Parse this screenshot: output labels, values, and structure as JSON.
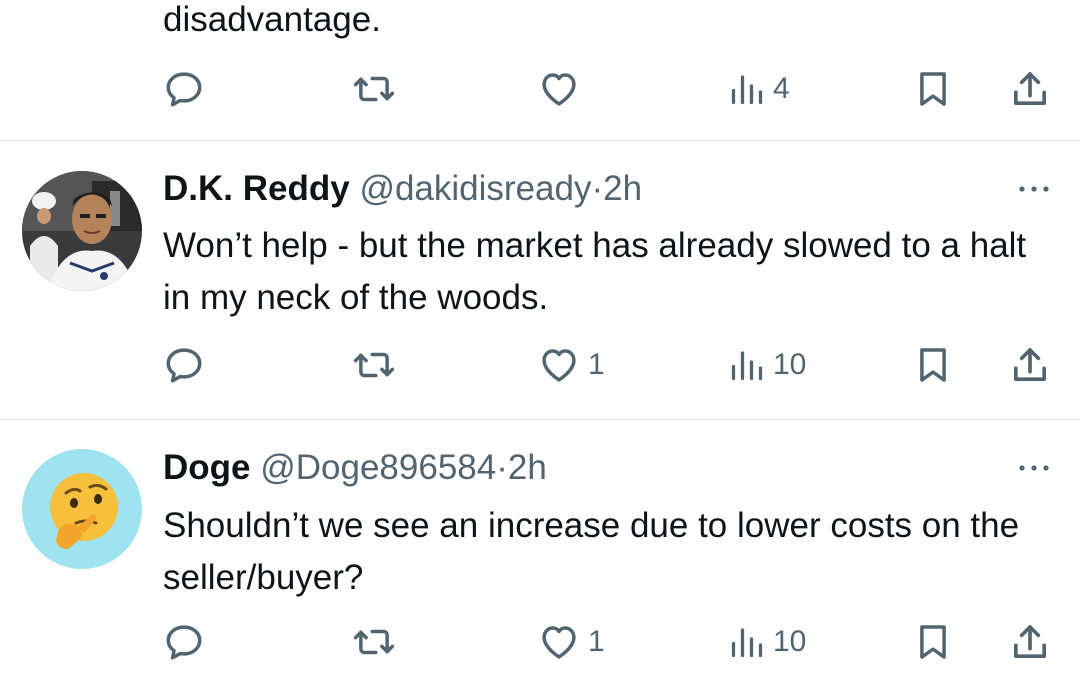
{
  "tweets": [
    {
      "text_tail": "disadvantage.",
      "actions": {
        "reply": "",
        "retweet": "",
        "like": "",
        "views": "4"
      }
    },
    {
      "name": "D.K. Reddy",
      "handle": "@dakidisready",
      "dot": "·",
      "time": "2h",
      "text": "Won’t help - but the market has already slowed to a halt in my neck of the woods.",
      "avatar": "profile-photo",
      "actions": {
        "reply": "",
        "retweet": "",
        "like": "1",
        "views": "10"
      }
    },
    {
      "name": "Doge",
      "handle": "@Doge896584",
      "dot": "·",
      "time": "2h",
      "text": "Shouldn’t we see an increase due to lower costs on the seller/buyer?",
      "avatar": "thinking-face-emoji",
      "actions": {
        "reply": "",
        "retweet": "",
        "like": "1",
        "views": "10"
      }
    }
  ],
  "icons": {
    "reply": "reply-icon",
    "retweet": "retweet-icon",
    "like": "like-icon",
    "views": "views-icon",
    "bookmark": "bookmark-icon",
    "share": "share-icon",
    "more": "more-icon"
  },
  "colors": {
    "text": "#0f1419",
    "muted": "#536471",
    "divider": "#e1e4e7",
    "avatar_bg": "#9fe3f0"
  }
}
